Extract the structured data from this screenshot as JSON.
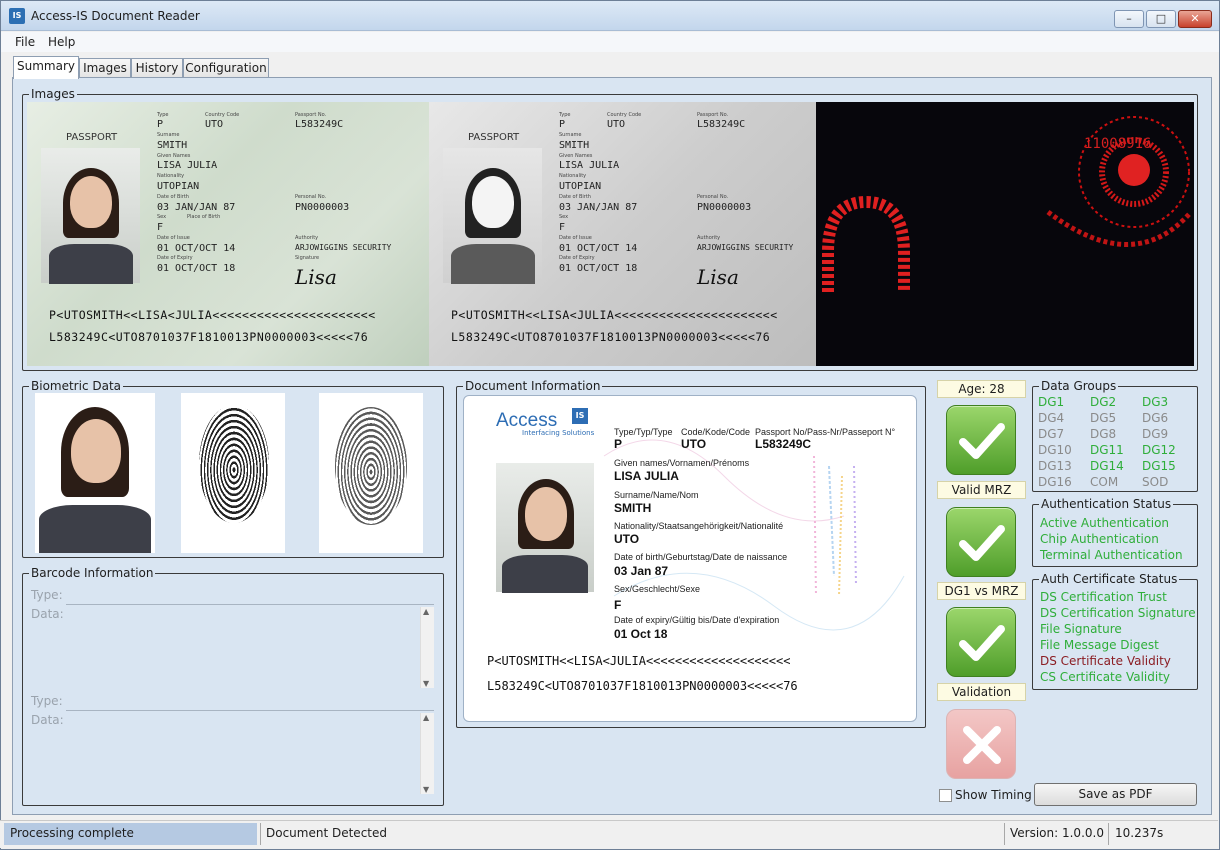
{
  "window": {
    "title": "Access-IS Document Reader",
    "app_icon": "IS"
  },
  "menu": {
    "file": "File",
    "help": "Help"
  },
  "tabs": [
    "Summary",
    "Images",
    "History",
    "Configuration"
  ],
  "images": {
    "label": "Images",
    "passport": {
      "header": "PASSPORT",
      "type_label": "Type",
      "type": "P",
      "country_label": "Country Code",
      "country": "UTO",
      "passno_label": "Passport No.",
      "passno": "L583249C",
      "surname_label": "Surname",
      "surname": "SMITH",
      "given_label": "Given Names",
      "given": "LISA JULIA",
      "nationality_label": "Nationality",
      "nationality": "UTOPIAN",
      "dob_label": "Date of Birth",
      "dob": "03 JAN/JAN 87",
      "personal_label": "Personal No.",
      "personal": "PN0000003",
      "sex_label": "Sex",
      "pob_label": "Place of Birth",
      "sex": "F",
      "issue_label": "Date of Issue",
      "issue": "01 OCT/OCT 14",
      "authority_label": "Authority",
      "authority": "ARJOWIGGINS SECURITY",
      "expiry_label": "Date of Expiry",
      "expiry": "01 OCT/OCT 18",
      "signature_label": "Signature",
      "signature": "Lisa",
      "mrz1": "P<UTOSMITH<<LISA<JULIA<<<<<<<<<<<<<<<<<<<<<<",
      "mrz2": "L583249C<UTO8701037F1810013PN0000003<<<<<76"
    },
    "uv": {
      "text": "11008916"
    }
  },
  "biometric": {
    "label": "Biometric Data"
  },
  "barcode": {
    "label": "Barcode Information",
    "type_label": "Type:",
    "data_label": "Data:",
    "type2_label": "Type:",
    "data2_label": "Data:"
  },
  "document": {
    "label": "Document Information",
    "brand": "Access",
    "brand_badge": "IS",
    "brand_sub": "Interfacing Solutions",
    "type_label": "Type/Typ/Type",
    "type": "P",
    "code_label": "Code/Kode/Code",
    "code": "UTO",
    "passno_label": "Passport No/Pass-Nr/Passeport N°",
    "passno": "L583249C",
    "given_label": "Given names/Vornamen/Prénoms",
    "given": "LISA JULIA",
    "surname_label": "Surname/Name/Nom",
    "surname": "SMITH",
    "nationality_label": "Nationality/Staatsangehörigkeit/Nationalité",
    "nationality": "UTO",
    "dob_label": "Date of birth/Geburtstag/Date de naissance",
    "dob": "03 Jan 87",
    "sex_label": "Sex/Geschlecht/Sexe",
    "sex": "F",
    "expiry_label": "Date of expiry/Gültig bis/Date d'expiration",
    "expiry": "01 Oct 18",
    "mrz1": "P<UTOSMITH<<LISA<JULIA<<<<<<<<<<<<<<<<<<<<",
    "mrz2": "L583249C<UTO8701037F1810013PN0000003<<<<<76"
  },
  "checks": {
    "age": "Age: 28",
    "valid_mrz": "Valid MRZ",
    "dg1_vs_mrz": "DG1 vs MRZ",
    "validation": "Validation",
    "results": [
      "pass",
      "pass",
      "pass",
      "fail"
    ]
  },
  "data_groups": {
    "label": "Data Groups",
    "items": [
      {
        "name": "DG1",
        "state": "ok"
      },
      {
        "name": "DG2",
        "state": "ok"
      },
      {
        "name": "DG3",
        "state": "ok"
      },
      {
        "name": "DG4",
        "state": "absent"
      },
      {
        "name": "DG5",
        "state": "absent"
      },
      {
        "name": "DG6",
        "state": "absent"
      },
      {
        "name": "DG7",
        "state": "absent"
      },
      {
        "name": "DG8",
        "state": "absent"
      },
      {
        "name": "DG9",
        "state": "absent"
      },
      {
        "name": "DG10",
        "state": "absent"
      },
      {
        "name": "DG11",
        "state": "ok"
      },
      {
        "name": "DG12",
        "state": "ok"
      },
      {
        "name": "DG13",
        "state": "absent"
      },
      {
        "name": "DG14",
        "state": "ok"
      },
      {
        "name": "DG15",
        "state": "ok"
      },
      {
        "name": "DG16",
        "state": "absent"
      },
      {
        "name": "COM",
        "state": "absent"
      },
      {
        "name": "SOD",
        "state": "absent"
      }
    ]
  },
  "authentication": {
    "label": "Authentication Status",
    "items": [
      "Active Authentication",
      "Chip Authentication",
      "Terminal Authentication"
    ]
  },
  "auth_cert": {
    "label": "Auth Certificate Status",
    "items": [
      {
        "name": "DS Certification Trust",
        "state": "ok"
      },
      {
        "name": "DS Certification Signature",
        "state": "ok"
      },
      {
        "name": "File Signature",
        "state": "ok"
      },
      {
        "name": "File Message Digest",
        "state": "ok"
      },
      {
        "name": "DS Certificate Validity",
        "state": "fail"
      },
      {
        "name": "CS Certificate Validity",
        "state": "ok"
      }
    ]
  },
  "controls": {
    "show_timing": "Show Timing",
    "save_pdf": "Save as PDF"
  },
  "statusbar": {
    "processing": "Processing complete",
    "detected": "Document Detected",
    "version": "Version: 1.0.0.0",
    "time": "10.237s"
  },
  "colors": {
    "ok": "#2fae3a",
    "absent": "#8a8a8a",
    "fail": "#8b1d23",
    "progress": "#b5c9e2"
  }
}
